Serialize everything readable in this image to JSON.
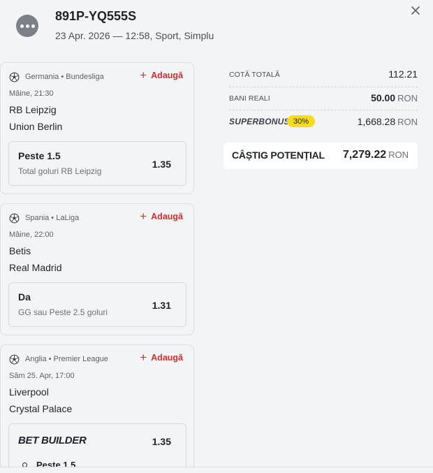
{
  "header": {
    "ticket_id": "891P-YQ555S",
    "meta": "23 Apr. 2026 — 12:58, Sport, Simplu",
    "menu_icon": "more-dots-icon",
    "close_icon": "close-icon"
  },
  "events": [
    {
      "league": "Germania • Bundesliga",
      "add_label": "Adaugă",
      "kickoff": "Mâine, 21:30",
      "home": "RB Leipzig",
      "away": "Union Berlin",
      "bet_name": "Peste 1.5",
      "bet_desc": "Total goluri RB Leipzig",
      "odd": "1.35"
    },
    {
      "league": "Spania • LaLiga",
      "add_label": "Adaugă",
      "kickoff": "Mâine, 22:00",
      "home": "Betis",
      "away": "Real Madrid",
      "bet_name": "Da",
      "bet_desc": "GG sau Peste 2.5 goluri",
      "odd": "1.31"
    },
    {
      "league": "Anglia • Premier League",
      "add_label": "Adaugă",
      "kickoff": "Sâm 25. Apr, 17:00",
      "home": "Liverpool",
      "away": "Crystal Palace",
      "builder_title": "BET BUILDER",
      "odd": "1.35",
      "builder_first_item": "Peste 1.5"
    }
  ],
  "summary": {
    "total_odds_label": "COTĂ TOTALĂ",
    "total_odds_value": "112.21",
    "stake_label": "BANI REALI",
    "stake_value": "50.00",
    "currency": "RON",
    "superbonus_label": "SUPERBONUS",
    "superbonus_percent": "30%",
    "superbonus_value": "1,668.28",
    "potential_win_label": "CÂȘTIG POTENȚIAL",
    "potential_win_value": "7,279.22"
  },
  "colors": {
    "accent_red": "#d92b2b",
    "badge_yellow": "#f7dc1b",
    "background": "#f3f4f6"
  }
}
